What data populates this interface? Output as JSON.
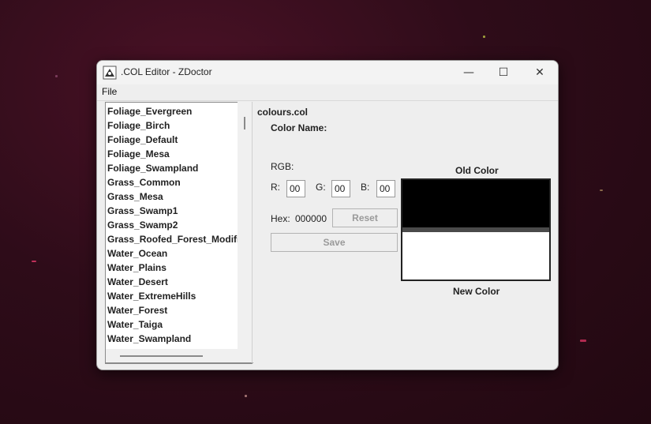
{
  "window": {
    "title": ".COL Editor - ZDoctor",
    "controls": {
      "minimize": "—",
      "maximize": "☐",
      "close": "✕"
    }
  },
  "menu": {
    "file": "File"
  },
  "color_list": [
    "Foliage_Evergreen",
    "Foliage_Birch",
    "Foliage_Default",
    "Foliage_Mesa",
    "Foliage_Swampland",
    "Grass_Common",
    "Grass_Mesa",
    "Grass_Swamp1",
    "Grass_Swamp2",
    "Grass_Roofed_Forest_Modifi",
    "Water_Ocean",
    "Water_Plains",
    "Water_Desert",
    "Water_ExtremeHills",
    "Water_Forest",
    "Water_Taiga",
    "Water_Swampland"
  ],
  "editor": {
    "file_name": "colours.col",
    "color_name_label": "Color Name:",
    "rgb_label": "RGB:",
    "r_label": "R:",
    "g_label": "G:",
    "b_label": "B:",
    "r_value": "00",
    "g_value": "00",
    "b_value": "00",
    "hex_label": "Hex:",
    "hex_value": "000000",
    "reset_button": "Reset",
    "save_button": "Save"
  },
  "preview": {
    "old_label": "Old Color",
    "new_label": "New Color",
    "old_color": "#000000",
    "new_color": "#ffffff"
  }
}
